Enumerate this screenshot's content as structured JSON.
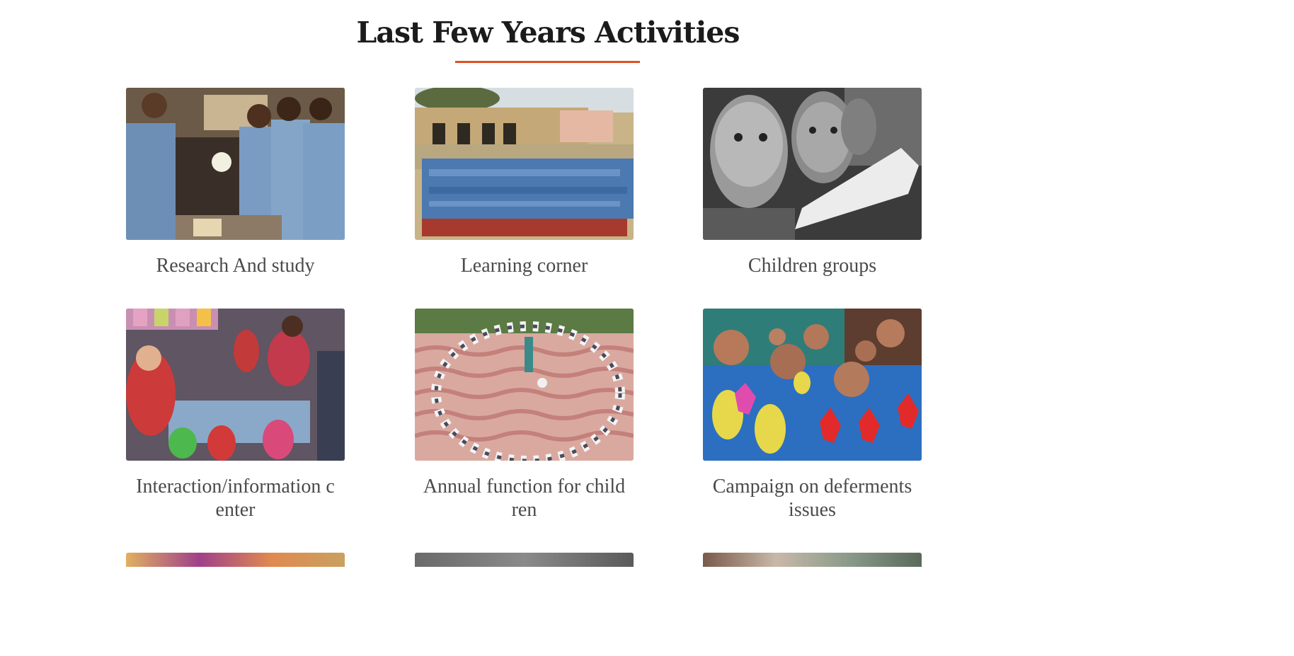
{
  "section": {
    "title": "Last Few Years Activities"
  },
  "activities": [
    {
      "caption": "Research And study",
      "image": "students-science-experiment"
    },
    {
      "caption": "Learning corner",
      "image": "children-seated-outside-school"
    },
    {
      "caption": "Children groups",
      "image": "girls-reading-black-and-white"
    },
    {
      "caption": "Interaction/information center",
      "image": "children-circle-indoor"
    },
    {
      "caption": "Annual function for children",
      "image": "children-circle-courtyard"
    },
    {
      "caption": "Campaign on deferments issues",
      "image": "girls-painted-hands"
    }
  ],
  "colors": {
    "accent": "#e2501f",
    "title": "#1b1b1b",
    "caption": "#4a4a4a"
  }
}
